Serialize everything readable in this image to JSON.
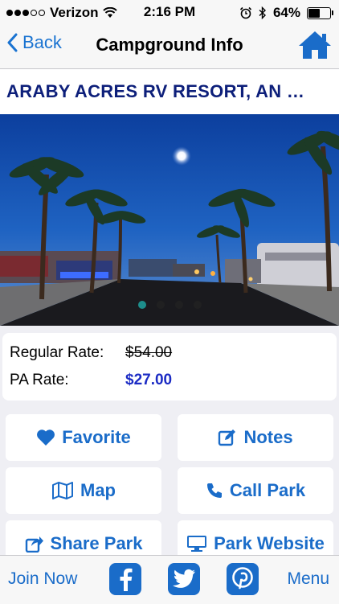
{
  "status_bar": {
    "carrier": "Verizon",
    "time": "2:16 PM",
    "battery": "64%",
    "battery_level": 0.64
  },
  "nav": {
    "back_label": "Back",
    "title": "Campground Info",
    "home_icon": "home-icon"
  },
  "park": {
    "name": "ARABY ACRES RV RESORT, AN …"
  },
  "carousel": {
    "total": 4,
    "active_index": 0
  },
  "rates": {
    "regular_label": "Regular Rate:",
    "regular_value": "$54.00",
    "pa_label": "PA Rate:",
    "pa_value": "$27.00"
  },
  "actions": {
    "favorite": "Favorite",
    "notes": "Notes",
    "map": "Map",
    "call_park": "Call Park",
    "share_park": "Share Park",
    "park_website": "Park Website"
  },
  "toolbar": {
    "join_now": "Join Now",
    "menu": "Menu"
  },
  "colors": {
    "accent": "#1a6cc9",
    "park_name": "#0d1f7a",
    "pa_rate": "#1b2bc4",
    "carousel_active": "#1fa3a0"
  }
}
